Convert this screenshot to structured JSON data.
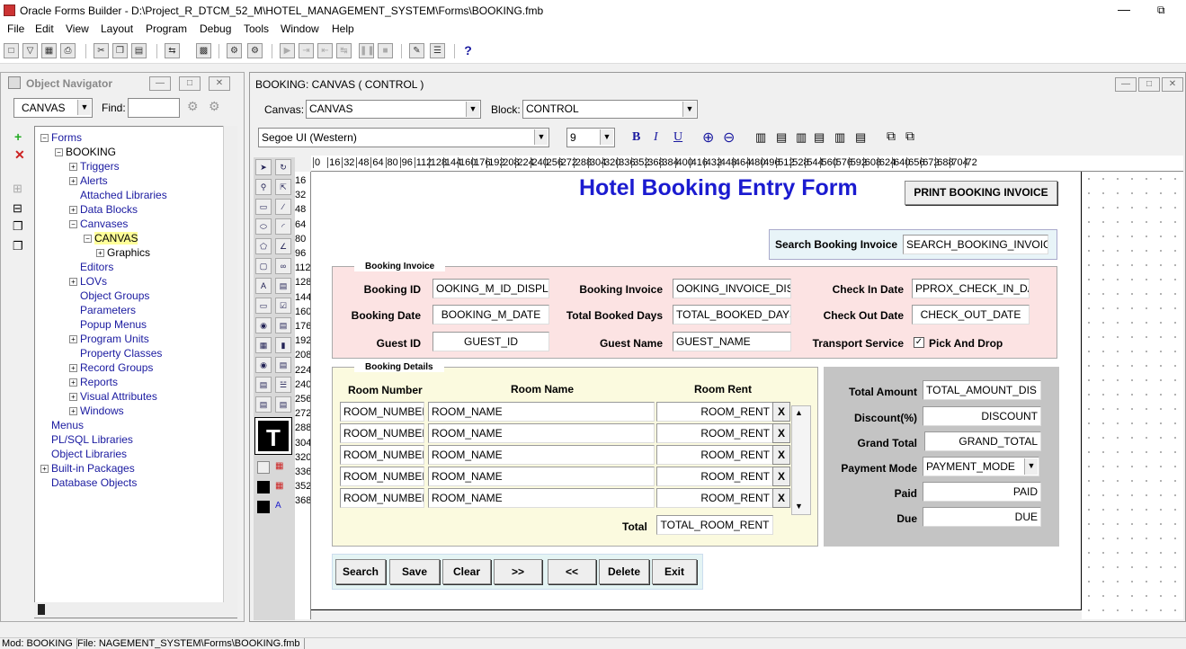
{
  "window": {
    "title": "Oracle Forms Builder - D:\\Project_R_DTCM_52_M\\HOTEL_MANAGEMENT_SYSTEM\\Forms\\BOOKING.fmb"
  },
  "menu": [
    "File",
    "Edit",
    "View",
    "Layout",
    "Program",
    "Debug",
    "Tools",
    "Window",
    "Help"
  ],
  "navigator": {
    "title": "Object Navigator",
    "context": "CANVAS",
    "find_label": "Find:",
    "tree": {
      "forms": "Forms",
      "booking": "BOOKING",
      "triggers": "Triggers",
      "alerts": "Alerts",
      "attached": "Attached Libraries",
      "blocks": "Data Blocks",
      "canvases": "Canvases",
      "canvas": "CANVAS",
      "graphics": "Graphics",
      "editors": "Editors",
      "lovs": "LOVs",
      "objgroups": "Object Groups",
      "parameters": "Parameters",
      "popup": "Popup Menus",
      "progunits": "Program Units",
      "propclasses": "Property Classes",
      "recgroups": "Record Groups",
      "reports": "Reports",
      "visattr": "Visual Attributes",
      "windows": "Windows",
      "menus": "Menus",
      "plsql": "PL/SQL Libraries",
      "objlibs": "Object Libraries",
      "builtin": "Built-in Packages",
      "dbobjects": "Database Objects"
    }
  },
  "canvas_window": {
    "title": "BOOKING: CANVAS ( CONTROL )",
    "canvas_label": "Canvas:",
    "canvas_value": "CANVAS",
    "block_label": "Block:",
    "block_value": "CONTROL",
    "font": "Segoe UI (Western)",
    "size": "9"
  },
  "ruler": {
    "h": [
      "0",
      "16",
      "32",
      "48",
      "64",
      "80",
      "96",
      "112",
      "128",
      "144",
      "160",
      "176",
      "192",
      "208",
      "224",
      "240",
      "256",
      "272",
      "288",
      "304",
      "320",
      "336",
      "352",
      "368",
      "384",
      "400",
      "416",
      "432",
      "448",
      "464",
      "480",
      "496",
      "512",
      "528",
      "544",
      "560",
      "576",
      "592",
      "608",
      "624",
      "640",
      "656",
      "672",
      "688",
      "704",
      "72"
    ],
    "v": [
      "16",
      "32",
      "48",
      "64",
      "80",
      "96",
      "112",
      "128",
      "144",
      "160",
      "176",
      "192",
      "208",
      "224",
      "240",
      "256",
      "272",
      "288",
      "304",
      "320",
      "336",
      "352",
      "368"
    ]
  },
  "form": {
    "title": "Hotel Booking Entry Form",
    "print_button": "PRINT BOOKING INVOICE",
    "search_label": "Search Booking Invoice",
    "search_field": "SEARCH_BOOKING_INVOICE",
    "booking_invoice_frame": "Booking Invoice",
    "booking_id_label": "Booking  ID",
    "booking_id": "OOKING_M_ID_DISPLA",
    "booking_inv_label": "Booking Invoice",
    "booking_inv": "OOKING_INVOICE_DISPL",
    "checkin_label": "Check In Date",
    "checkin": "PPROX_CHECK_IN_DAT",
    "booking_date_label": "Booking  Date",
    "booking_date": "BOOKING_M_DATE",
    "total_days_label": "Total Booked Days",
    "total_days": "TOTAL_BOOKED_DAYS",
    "checkout_label": "Check Out Date",
    "checkout": "CHECK_OUT_DATE",
    "guest_id_label": "Guest ID",
    "guest_id": "GUEST_ID",
    "guest_name_label": "Guest Name",
    "guest_name": "GUEST_NAME",
    "transport_label": "Transport Service",
    "pickdrop_label": "Pick And Drop",
    "booking_details_frame": "Booking Details",
    "col_room_number": "Room Number",
    "col_room_name": "Room Name",
    "col_room_rent": "Room Rent",
    "rows": [
      {
        "number": "ROOM_NUMBER",
        "name": "ROOM_NAME",
        "rent": "ROOM_RENT",
        "x": "X"
      },
      {
        "number": "ROOM_NUMBER",
        "name": "ROOM_NAME",
        "rent": "ROOM_RENT",
        "x": "X"
      },
      {
        "number": "ROOM_NUMBER",
        "name": "ROOM_NAME",
        "rent": "ROOM_RENT",
        "x": "X"
      },
      {
        "number": "ROOM_NUMBER",
        "name": "ROOM_NAME",
        "rent": "ROOM_RENT",
        "x": "X"
      },
      {
        "number": "ROOM_NUMBER",
        "name": "ROOM_NAME",
        "rent": "ROOM_RENT",
        "x": "X"
      }
    ],
    "total_label": "Total",
    "total_room_rent": "TOTAL_ROOM_RENT",
    "total_amount_label": "Total Amount",
    "total_amount": "TOTAL_AMOUNT_DIS",
    "discount_label": "Discount(%)",
    "discount": "DISCOUNT",
    "grand_total_label": "Grand Total",
    "grand_total": "GRAND_TOTAL",
    "payment_mode_label": "Payment Mode",
    "payment_mode": "PAYMENT_MODE",
    "paid_label": "Paid",
    "paid": "PAID",
    "due_label": "Due",
    "due": "DUE",
    "buttons": {
      "search": "Search",
      "save": "Save",
      "clear": "Clear",
      "next": ">>",
      "prev": "<<",
      "delete": "Delete",
      "exit": "Exit"
    }
  },
  "status": {
    "module": "Mod: BOOKING",
    "file": "File: NAGEMENT_SYSTEM\\Forms\\BOOKING.fmb"
  }
}
